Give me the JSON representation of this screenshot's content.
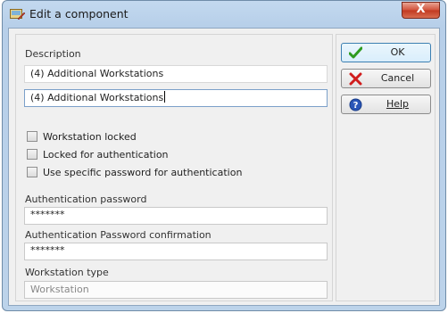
{
  "window": {
    "title": "Edit a component",
    "close_glyph": "X"
  },
  "form": {
    "description_label": "Description",
    "description_value": "(4)  Additional Workstations",
    "description_input_value": "(4)  Additional Workstations",
    "checkboxes": [
      {
        "label": "Workstation locked",
        "checked": false
      },
      {
        "label": "Locked for authentication",
        "checked": false
      },
      {
        "label": "Use specific password for authentication",
        "checked": false
      }
    ],
    "auth_password_label": "Authentication password",
    "auth_password_value": "*******",
    "auth_password_confirm_label": "Authentication Password confirmation",
    "auth_password_confirm_value": "*******",
    "workstation_type_label": "Workstation type",
    "workstation_type_value": "Workstation"
  },
  "buttons": {
    "ok": {
      "label": "OK",
      "icon": "check-icon",
      "color": "#2e9b1f"
    },
    "cancel": {
      "label": "Cancel",
      "icon": "cross-icon",
      "color": "#d01c1c"
    },
    "help": {
      "label": "Help",
      "icon": "help-icon",
      "color": "#2a56b8"
    }
  }
}
